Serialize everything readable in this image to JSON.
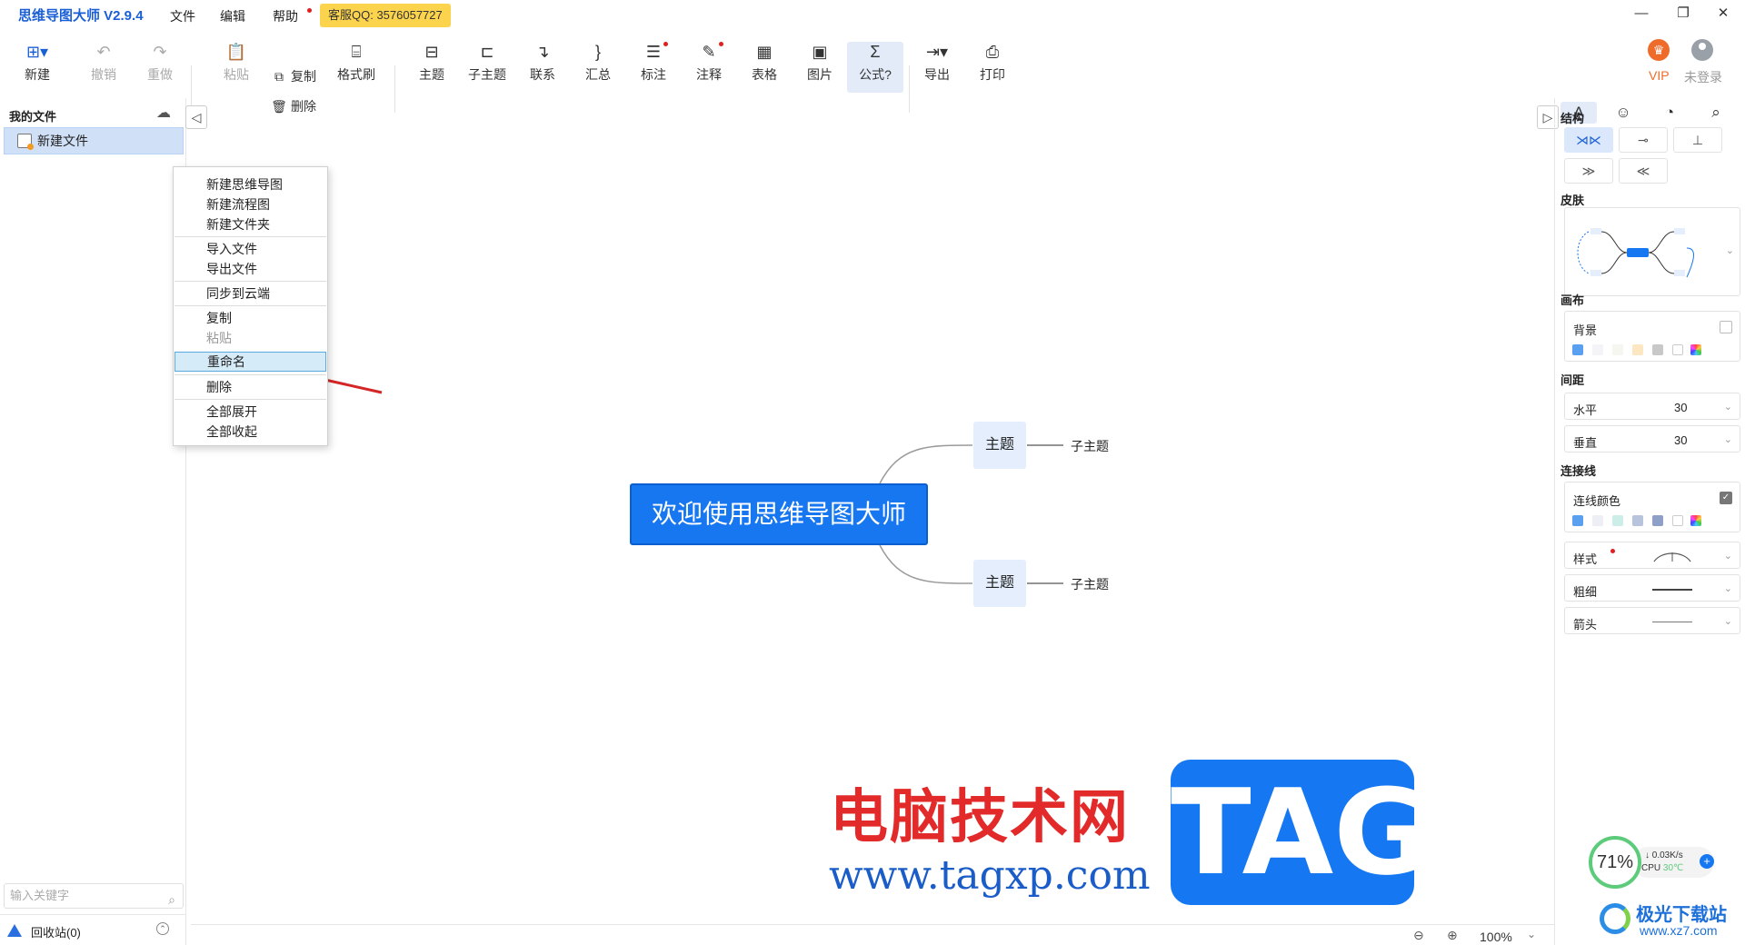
{
  "app": {
    "title": "思维导图大师 V2.9.4",
    "menus": [
      "文件",
      "编辑",
      "帮助"
    ],
    "qq_badge": "客服QQ: 3576057727",
    "window_controls": [
      "—",
      "❐",
      "✕"
    ]
  },
  "toolbar": {
    "new": "新建",
    "undo": "撤销",
    "redo": "重做",
    "paste": "粘贴",
    "copy": "复制",
    "delete": "删除",
    "format_brush": "格式刷",
    "topic": "主题",
    "subtopic": "子主题",
    "relation": "联系",
    "summary": "汇总",
    "mark": "标注",
    "note": "注释",
    "table": "表格",
    "image": "图片",
    "formula": "公式",
    "export": "导出",
    "print": "打印",
    "vip": "VIP",
    "login": "未登录"
  },
  "left_panel": {
    "title": "我的文件",
    "file_name": "新建文件",
    "search_placeholder": "输入关键字",
    "recycle": "回收站(0)"
  },
  "context_menu": {
    "items": [
      {
        "label": "新建思维导图",
        "disabled": false
      },
      {
        "label": "新建流程图",
        "disabled": false
      },
      {
        "label": "新建文件夹",
        "disabled": false
      },
      {
        "label": "导入文件",
        "disabled": false
      },
      {
        "label": "导出文件",
        "disabled": false
      },
      {
        "label": "同步到云端",
        "disabled": false
      },
      {
        "label": "复制",
        "disabled": false
      },
      {
        "label": "粘贴",
        "disabled": true
      },
      {
        "label": "重命名",
        "disabled": false,
        "highlighted": true
      },
      {
        "label": "删除",
        "disabled": false
      },
      {
        "label": "全部展开",
        "disabled": false
      },
      {
        "label": "全部收起",
        "disabled": false
      }
    ]
  },
  "canvas": {
    "central": "欢迎使用思维导图大师",
    "topics": [
      {
        "label": "主题",
        "subtopic": "子主题"
      },
      {
        "label": "主题",
        "subtopic": "子主题"
      }
    ],
    "zoom": "100%"
  },
  "right_panel": {
    "structure": "结构",
    "skin": "皮肤",
    "canvas": "画布",
    "background": "背景",
    "spacing": "间距",
    "horizontal": "水平",
    "horizontal_value": "30",
    "vertical": "垂直",
    "vertical_value": "30",
    "connector": "连接线",
    "line_color": "连线颜色",
    "style": "样式",
    "thickness": "粗细",
    "arrow": "箭头",
    "bg_swatches": [
      "#5aa0f0",
      "#f3f3f8",
      "#f6f6f0",
      "#fde7c3",
      "#c8c8c8",
      "#ffffff",
      "rainbow"
    ],
    "line_swatches": [
      "#5aa0f0",
      "#eeeef6",
      "#cdeee8",
      "#b8c4dc",
      "#8fa0c8",
      "#ffffff",
      "rainbow"
    ]
  },
  "watermark": {
    "cn": "电脑技术网",
    "url": "www.tagxp.com",
    "tag": "TAG",
    "site_cn": "极光下载站",
    "site_url": "www.xz7.com"
  },
  "perf": {
    "percent": "71%",
    "net": "0.03K/s",
    "cpu_label": "CPU",
    "cpu_temp": "30℃"
  },
  "colors": {
    "accent": "#1677f0",
    "title_blue": "#1a5fd6",
    "arrow_red": "#d42626",
    "vip_orange": "#ef6b2a"
  }
}
